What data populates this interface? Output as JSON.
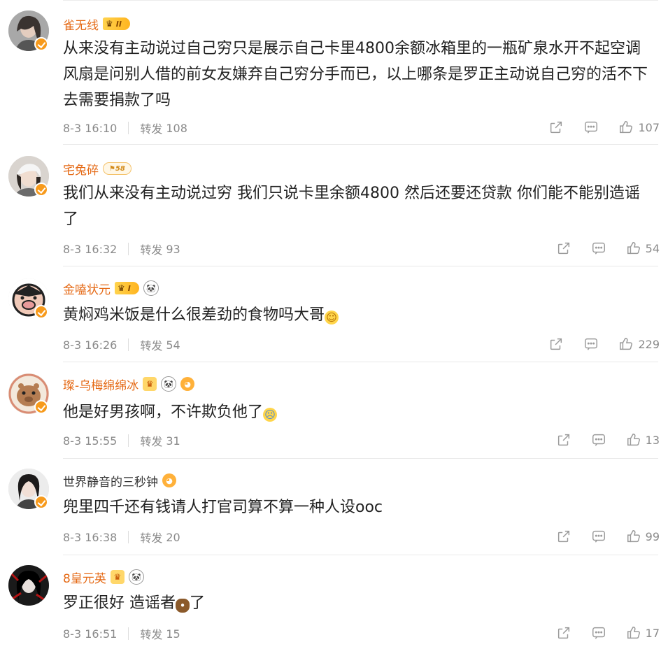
{
  "comments": [
    {
      "username": "雀无线",
      "badge": "II",
      "text": "从来没有主动说过自己穷只是展示自己卡里4800余额冰箱里的一瓶矿泉水开不起空调风扇是问别人借的前女友嫌弃自己穷分手而已，以上哪条是罗正主动说自己穷的活不下去需要捐款了吗",
      "time": "8-3 16:10",
      "repost_label": "转发",
      "repost_count": "108",
      "likes": "107"
    },
    {
      "username": "宅兔碎",
      "badge": "58",
      "text": "我们从来没有主动说过穷 我们只说卡里余额4800 然后还要还贷款 你们能不能别造谣了",
      "time": "8-3 16:32",
      "repost_label": "转发",
      "repost_count": "93",
      "likes": "54"
    },
    {
      "username": "金嗑状元",
      "badge": "I",
      "text": "黄焖鸡米饭是什么很差劲的食物吗大哥",
      "time": "8-3 16:26",
      "repost_label": "转发",
      "repost_count": "54",
      "likes": "229"
    },
    {
      "username": "璨-乌梅绵绵冰",
      "text": "他是好男孩啊，不许欺负他了",
      "time": "8-3 15:55",
      "repost_label": "转发",
      "repost_count": "31",
      "likes": "13"
    },
    {
      "username": "世界静音的三秒钟",
      "text": "兜里四千还有钱请人打官司算不算一种人设ooc",
      "time": "8-3 16:38",
      "repost_label": "转发",
      "repost_count": "20",
      "likes": "99"
    },
    {
      "username": "8皇元英",
      "text_a": "罗正很好 造谣者",
      "text_b": "了",
      "time": "8-3 16:51",
      "repost_label": "转发",
      "repost_count": "15",
      "likes": "17"
    }
  ],
  "icons": {
    "share": "share-icon",
    "comment": "comment-icon",
    "like": "thumbs-up-icon",
    "verified": "verified-badge-icon"
  },
  "colors": {
    "accent_username": "#e56a16",
    "text": "#222222",
    "meta": "#8a8a8a",
    "verified_badge": "#f79a1c"
  }
}
